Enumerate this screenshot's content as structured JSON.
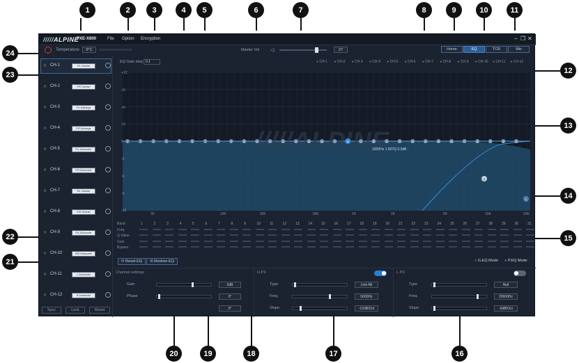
{
  "app": {
    "brand": "ALPINE",
    "model": "PXE-X800"
  },
  "menu": {
    "file": "File",
    "option": "Option",
    "encryption": "Encryption"
  },
  "window": {
    "minimize": "–",
    "restore": "❐",
    "close": "✕"
  },
  "toolbar": {
    "temperature_label": "Temperature",
    "temperature_value": "0°C",
    "master_vol_label": "Master Vol",
    "master_vol_value": "27"
  },
  "mode_tabs": {
    "home": "Home",
    "eq": "EQ",
    "tcr": "TCR",
    "mix": "Mix",
    "active": "EQ"
  },
  "channels": [
    {
      "name": "CH-1",
      "tag": "F/L-Tweeter"
    },
    {
      "name": "CH-2",
      "tag": "F/R-Tweeter"
    },
    {
      "name": "CH-3",
      "tag": "F/L-Midrange"
    },
    {
      "name": "CH-4",
      "tag": "F/R-Midrange"
    },
    {
      "name": "CH-5",
      "tag": "F/L-Subwoofer"
    },
    {
      "name": "CH-6",
      "tag": "F/R-Subwoofer"
    },
    {
      "name": "CH-7",
      "tag": "R/L-Tweeter"
    },
    {
      "name": "CH-8",
      "tag": "R/R-Tweeter"
    },
    {
      "name": "CH-9",
      "tag": "R/L-Subwoofer"
    },
    {
      "name": "CH-10",
      "tag": "R/R-Subwoofer"
    },
    {
      "name": "CH-11",
      "tag": "L-Subwoofer"
    },
    {
      "name": "CH-12",
      "tag": "R-Subwoofer"
    }
  ],
  "sidebar_buttons": {
    "sync": "Sync",
    "lock": "Lock",
    "reset": "Reset"
  },
  "eq": {
    "gain_step_label": "EQ Gain step",
    "gain_step_value": "0.1",
    "legend": [
      "CH-1",
      "CH-2",
      "CH-3",
      "CH-4",
      "CH-5",
      "CH-6",
      "CH-7",
      "CH-8",
      "CH-9",
      "CH-10",
      "CH-11",
      "CH-12"
    ],
    "y_labels": [
      "+12",
      "+9",
      "+6",
      "+3",
      "0",
      "-3",
      "-6",
      "-9",
      "-12"
    ],
    "x_labels": [
      "30",
      "100",
      "200",
      "500",
      "1K",
      "2K",
      "5K",
      "10K",
      "20K"
    ],
    "tooltip": "1000Hz  1.007Q  0.0dB",
    "watermark": "ALPINE",
    "point_h": "H",
    "point_l": "L"
  },
  "band_table": {
    "rows": [
      "Band",
      "Freq.",
      "Q Value",
      "Gain",
      "Bypass"
    ],
    "bands": [
      "1",
      "2",
      "3",
      "4",
      "5",
      "6",
      "7",
      "8",
      "9",
      "10",
      "11",
      "12",
      "13",
      "14",
      "15",
      "16",
      "17",
      "18",
      "19",
      "20",
      "21",
      "22",
      "23",
      "24",
      "25",
      "26",
      "27",
      "28",
      "29",
      "30",
      "31"
    ]
  },
  "actions": {
    "reset_eq": "Reset EQ",
    "restore_eq": "Restore EQ",
    "geq": "G.EQ Mode",
    "peq": "P.EQ Mode"
  },
  "channel_settings": {
    "title": "Channel settings",
    "gain_label": "Gain",
    "gain_value": "0dB",
    "phase_label": "Phase",
    "phase_value": "0°",
    "phase_value2": "0°"
  },
  "hpf": {
    "title": "H.P.F",
    "type_label": "Type",
    "type_value": "Link-Ril",
    "freq_label": "Freq.",
    "freq_value": "5000Hz",
    "slope_label": "Slope",
    "slope_value": "-12dB/Oct"
  },
  "lpf": {
    "title": "L.P.F",
    "type_label": "Type",
    "type_value": "Null",
    "freq_label": "Freq.",
    "freq_value": "20000Hz",
    "slope_label": "Slope",
    "slope_value": "-6dB/Oct"
  },
  "callouts": [
    "1",
    "2",
    "3",
    "4",
    "5",
    "6",
    "7",
    "8",
    "9",
    "10",
    "11",
    "12",
    "13",
    "14",
    "15",
    "16",
    "17",
    "18",
    "19",
    "20",
    "21",
    "22",
    "23",
    "24"
  ]
}
